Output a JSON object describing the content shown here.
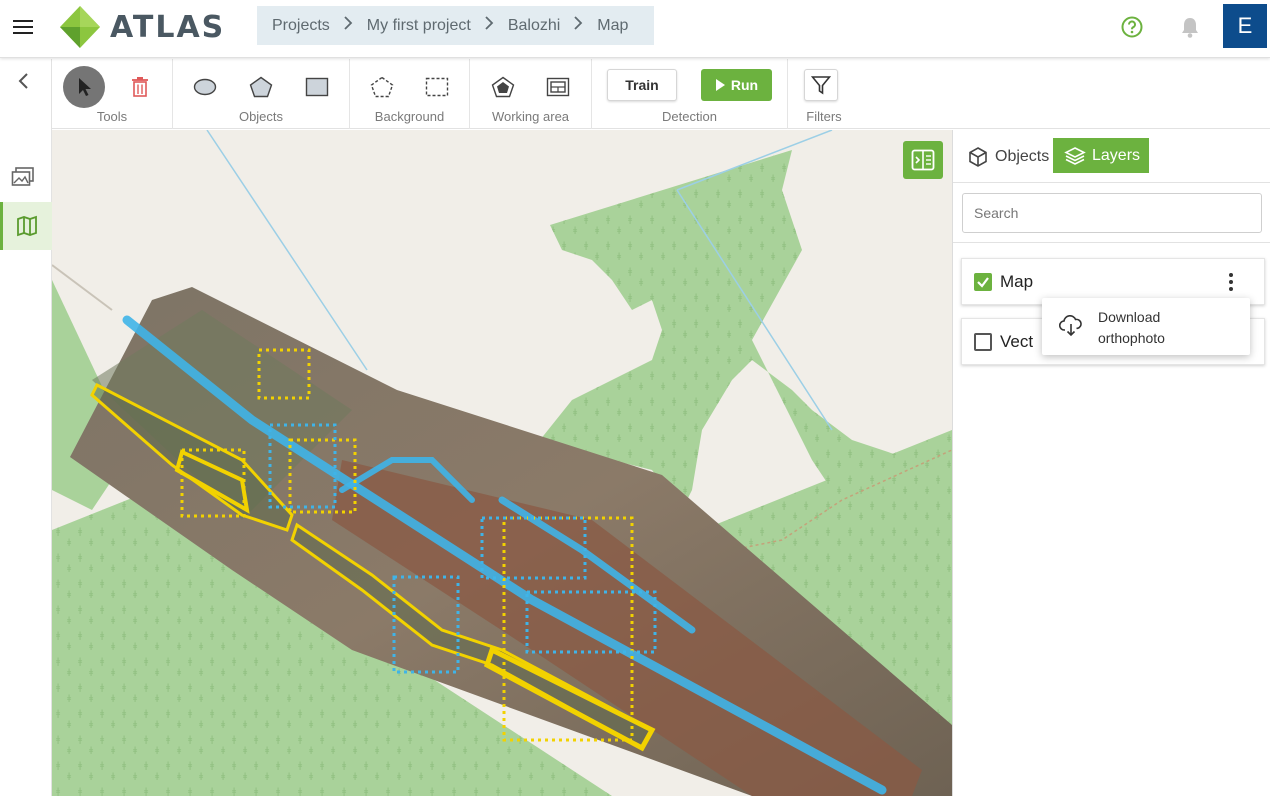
{
  "app": {
    "name": "ATLAS"
  },
  "breadcrumb": [
    "Projects",
    "My first project",
    "Balozhi",
    "Map"
  ],
  "user": {
    "initial": "E"
  },
  "toolbar": {
    "groups": {
      "tools": "Tools",
      "objects": "Objects",
      "background": "Background",
      "working_area": "Working area",
      "detection": "Detection",
      "filters": "Filters"
    },
    "train_label": "Train",
    "run_label": "Run"
  },
  "panel": {
    "tabs": {
      "objects": "Objects",
      "layers": "Layers"
    },
    "search_placeholder": "Search",
    "layers": [
      {
        "name": "Map",
        "checked": true
      },
      {
        "name": "Vect",
        "checked": false
      }
    ],
    "context_menu": {
      "line1": "Download",
      "line2": "orthophoto"
    }
  },
  "colors": {
    "accent": "#6cb23f",
    "avatar": "#0d4c8c",
    "annotation_yellow": "#f2d200",
    "annotation_blue": "#3fb4e8",
    "map_green": "#a9d29a",
    "map_bg": "#f1eee8"
  }
}
